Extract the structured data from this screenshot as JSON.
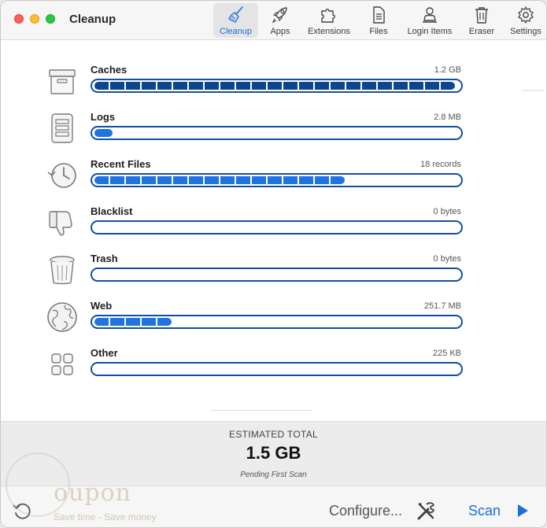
{
  "window": {
    "title": "Cleanup"
  },
  "toolbar": {
    "items": [
      {
        "label": "Cleanup",
        "icon": "broom-icon",
        "active": true
      },
      {
        "label": "Apps",
        "icon": "rocket-icon",
        "active": false
      },
      {
        "label": "Extensions",
        "icon": "puzzle-icon",
        "active": false
      },
      {
        "label": "Files",
        "icon": "document-icon",
        "active": false
      },
      {
        "label": "Login Items",
        "icon": "person-icon",
        "active": false
      },
      {
        "label": "Eraser",
        "icon": "trash-icon",
        "active": false
      },
      {
        "label": "Settings",
        "icon": "gear-icon",
        "active": false
      }
    ]
  },
  "categories": [
    {
      "name": "Caches",
      "size": "1.2 GB",
      "icon": "box-icon",
      "fill_fraction": 1.0,
      "style": "dark"
    },
    {
      "name": "Logs",
      "size": "2.8 MB",
      "icon": "log-file-icon",
      "fill_fraction": 0.05,
      "style": "light"
    },
    {
      "name": "Recent Files",
      "size": "18 records",
      "icon": "history-clock-icon",
      "fill_fraction": 0.7,
      "style": "light"
    },
    {
      "name": "Blacklist",
      "size": "0 bytes",
      "icon": "thumbs-down-icon",
      "fill_fraction": 0,
      "style": "light"
    },
    {
      "name": "Trash",
      "size": "0 bytes",
      "icon": "trash-bin-icon",
      "fill_fraction": 0,
      "style": "light"
    },
    {
      "name": "Web",
      "size": "251.7 MB",
      "icon": "globe-icon",
      "fill_fraction": 0.2,
      "style": "light"
    },
    {
      "name": "Other",
      "size": "225 KB",
      "icon": "grid-icon",
      "fill_fraction": 0,
      "style": "light"
    }
  ],
  "summary": {
    "label": "ESTIMATED TOTAL",
    "value": "1.5 GB",
    "status": "Pending First Scan"
  },
  "footer": {
    "configure_label": "Configure...",
    "scan_label": "Scan"
  },
  "watermark": {
    "text": "oupon",
    "tagline": "Save time - Save money"
  },
  "colors": {
    "accent": "#1a6fe0",
    "bar_border": "#0f4fa6",
    "bar_dark": "#0c4590",
    "bar_light": "#1f74e0"
  }
}
